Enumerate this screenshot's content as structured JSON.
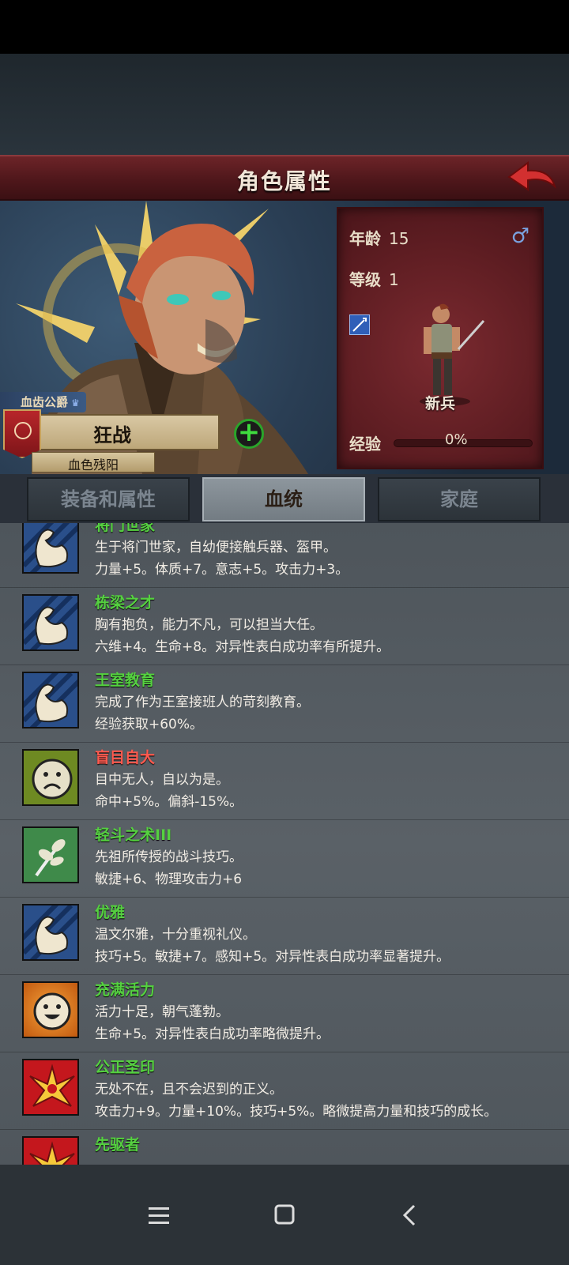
{
  "header": {
    "title": "角色属性"
  },
  "character": {
    "faction": "血齿公爵",
    "class": "狂战",
    "subtitle": "血色残阳"
  },
  "stats": {
    "age_label": "年龄",
    "age_value": "15",
    "gender_symbol": "♂",
    "level_label": "等级",
    "level_value": "1",
    "unit_label": "新兵",
    "exp_label": "经验",
    "exp_value": "0%",
    "exp_progress": 0
  },
  "tabs": [
    "装备和属性",
    "血统",
    "家庭"
  ],
  "active_tab": "血统",
  "traits": [
    {
      "name": "将门世家",
      "color": "green",
      "icon": "arm-icon",
      "desc": "生于将门世家，自幼便接触兵器、盔甲。",
      "effect": "力量+5。体质+7。意志+5。攻击力+3。"
    },
    {
      "name": "栋梁之才",
      "color": "green",
      "icon": "arm-icon",
      "desc": "胸有抱负，能力不凡，可以担当大任。",
      "effect": "六维+4。生命+8。对异性表白成功率有所提升。"
    },
    {
      "name": "王室教育",
      "color": "green",
      "icon": "arm-icon",
      "desc": "完成了作为王室接班人的苛刻教育。",
      "effect": "经验获取+60%。"
    },
    {
      "name": "盲目自大",
      "color": "red",
      "icon": "sad-face-icon",
      "desc": "目中无人，自以为是。",
      "effect": "命中+5%。偏斜-15%。"
    },
    {
      "name": "轻斗之术III",
      "color": "green",
      "icon": "leaf-icon",
      "desc": "先祖所传授的战斗技巧。",
      "effect": "敏捷+6、物理攻击力+6"
    },
    {
      "name": "优雅",
      "color": "green",
      "icon": "arm-icon",
      "desc": "温文尔雅，十分重视礼仪。",
      "effect": "技巧+5。敏捷+7。感知+5。对异性表白成功率显著提升。"
    },
    {
      "name": "充满活力",
      "color": "green",
      "icon": "happy-face-icon",
      "desc": "活力十足，朝气蓬勃。",
      "effect": "生命+5。对异性表白成功率略微提升。"
    },
    {
      "name": "公正圣印",
      "color": "green",
      "icon": "holy-seal-icon",
      "desc": "无处不在，且不会迟到的正义。",
      "effect": "攻击力+9。力量+10%。技巧+5%。略微提高力量和技巧的成长。"
    },
    {
      "name": "先驱者",
      "color": "green",
      "icon": "holy-seal-icon",
      "desc": "",
      "effect": ""
    }
  ],
  "colors": {
    "accent_red": "#6c2428",
    "trait_green": "#55d140",
    "trait_red": "#ff5a4f"
  }
}
